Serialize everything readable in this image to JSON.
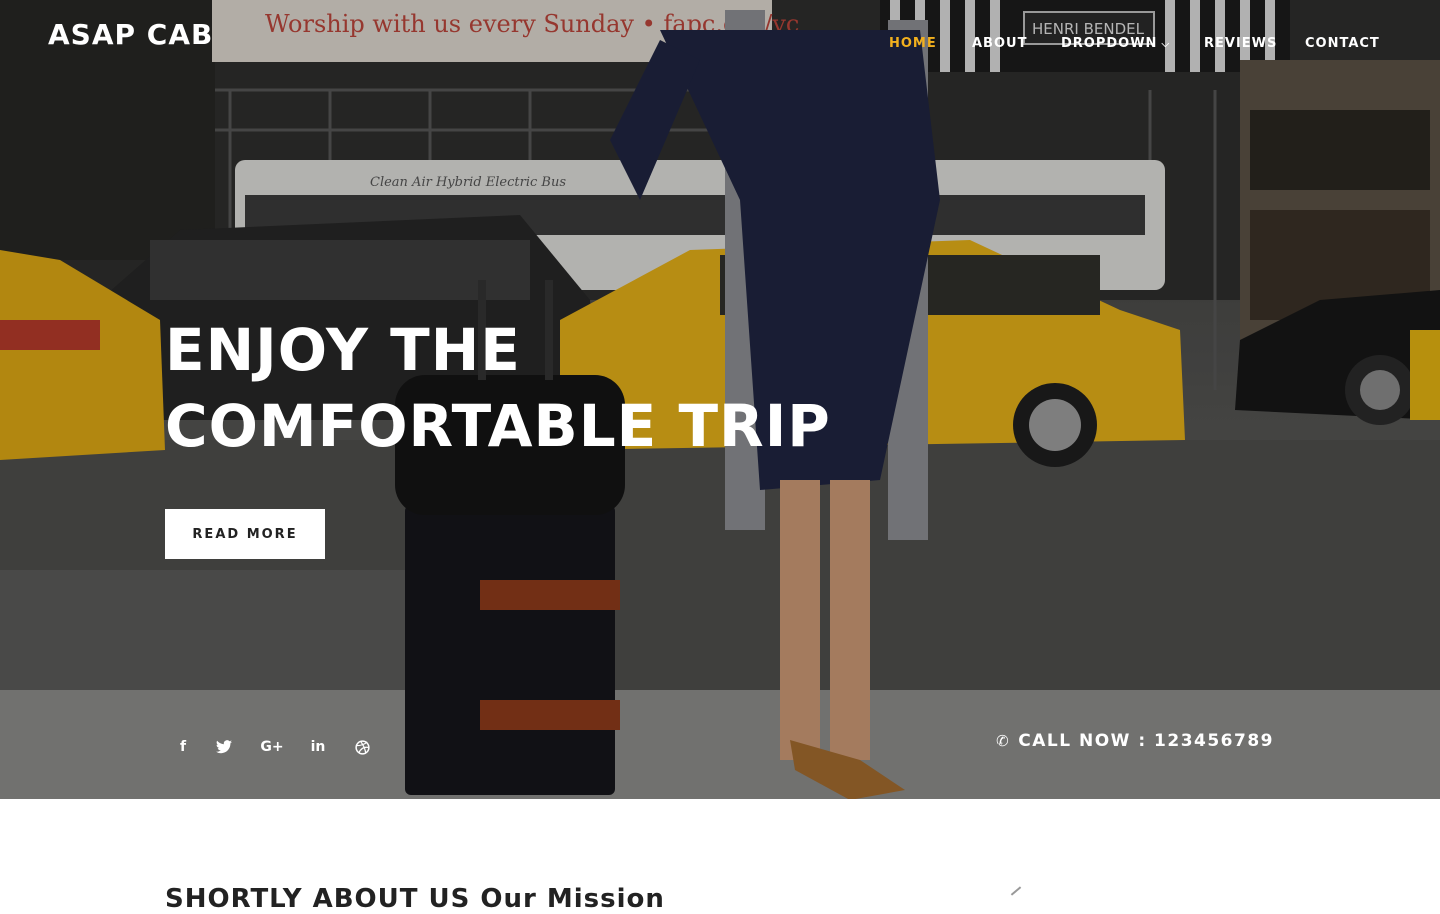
{
  "brand": {
    "name": "ASAP CAB"
  },
  "nav": {
    "items": [
      {
        "label": "HOME",
        "active": true
      },
      {
        "label": "ABOUT",
        "active": false
      },
      {
        "label": "DROPDOWN",
        "active": false,
        "has_caret": true
      },
      {
        "label": "REVIEWS",
        "active": false
      },
      {
        "label": "CONTACT",
        "active": false
      }
    ],
    "active_color": "#f2b01e"
  },
  "hero": {
    "headline_line1": "ENJOY THE",
    "headline_line2": "COMFORTABLE TRIP",
    "cta_label": "READ MORE",
    "call_label": "CALL NOW : 123456789",
    "social_icons": [
      "facebook-icon",
      "twitter-icon",
      "google-plus-icon",
      "linkedin-icon",
      "dribbble-icon"
    ],
    "background_signs": {
      "banner": "Worship with us every Sunday • fapc.org/vc",
      "store": "HENRI BENDEL",
      "bus": "Clean Air Hybrid Electric Bus"
    }
  },
  "about": {
    "title": "SHORTLY ABOUT US Our Mission"
  }
}
